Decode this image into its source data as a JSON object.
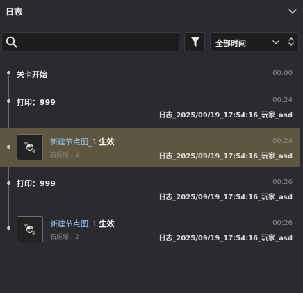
{
  "header": {
    "title": "日志"
  },
  "search": {
    "placeholder": ""
  },
  "time_filter": {
    "label": "全部时间"
  },
  "entries": [
    {
      "title": "关卡开始",
      "time": "00:00"
    },
    {
      "title": "打印：999",
      "time": "00:24",
      "log": "日志_2025/09/19_17:54:16_玩家_asd"
    },
    {
      "node": "新建节点图_1",
      "effect": "生效",
      "sub": "石质球 - 2",
      "time": "00:24",
      "log": "日志_2025/09/19_17:54:16_玩家_asd"
    },
    {
      "title": "打印：999",
      "time": "00:26",
      "log": "日志_2025/09/19_17:54:16_玩家_asd"
    },
    {
      "node": "新建节点图_1",
      "effect": "生效",
      "sub": "石质球 - 2",
      "time": "00:26",
      "log": "日志_2025/09/19_17:54:16_玩家_asd"
    }
  ],
  "colors": {
    "background": "#2b2b2f",
    "highlight_row": "#5f563f",
    "node_name": "#8fc4e6",
    "muted_text": "#8c8c8c"
  }
}
